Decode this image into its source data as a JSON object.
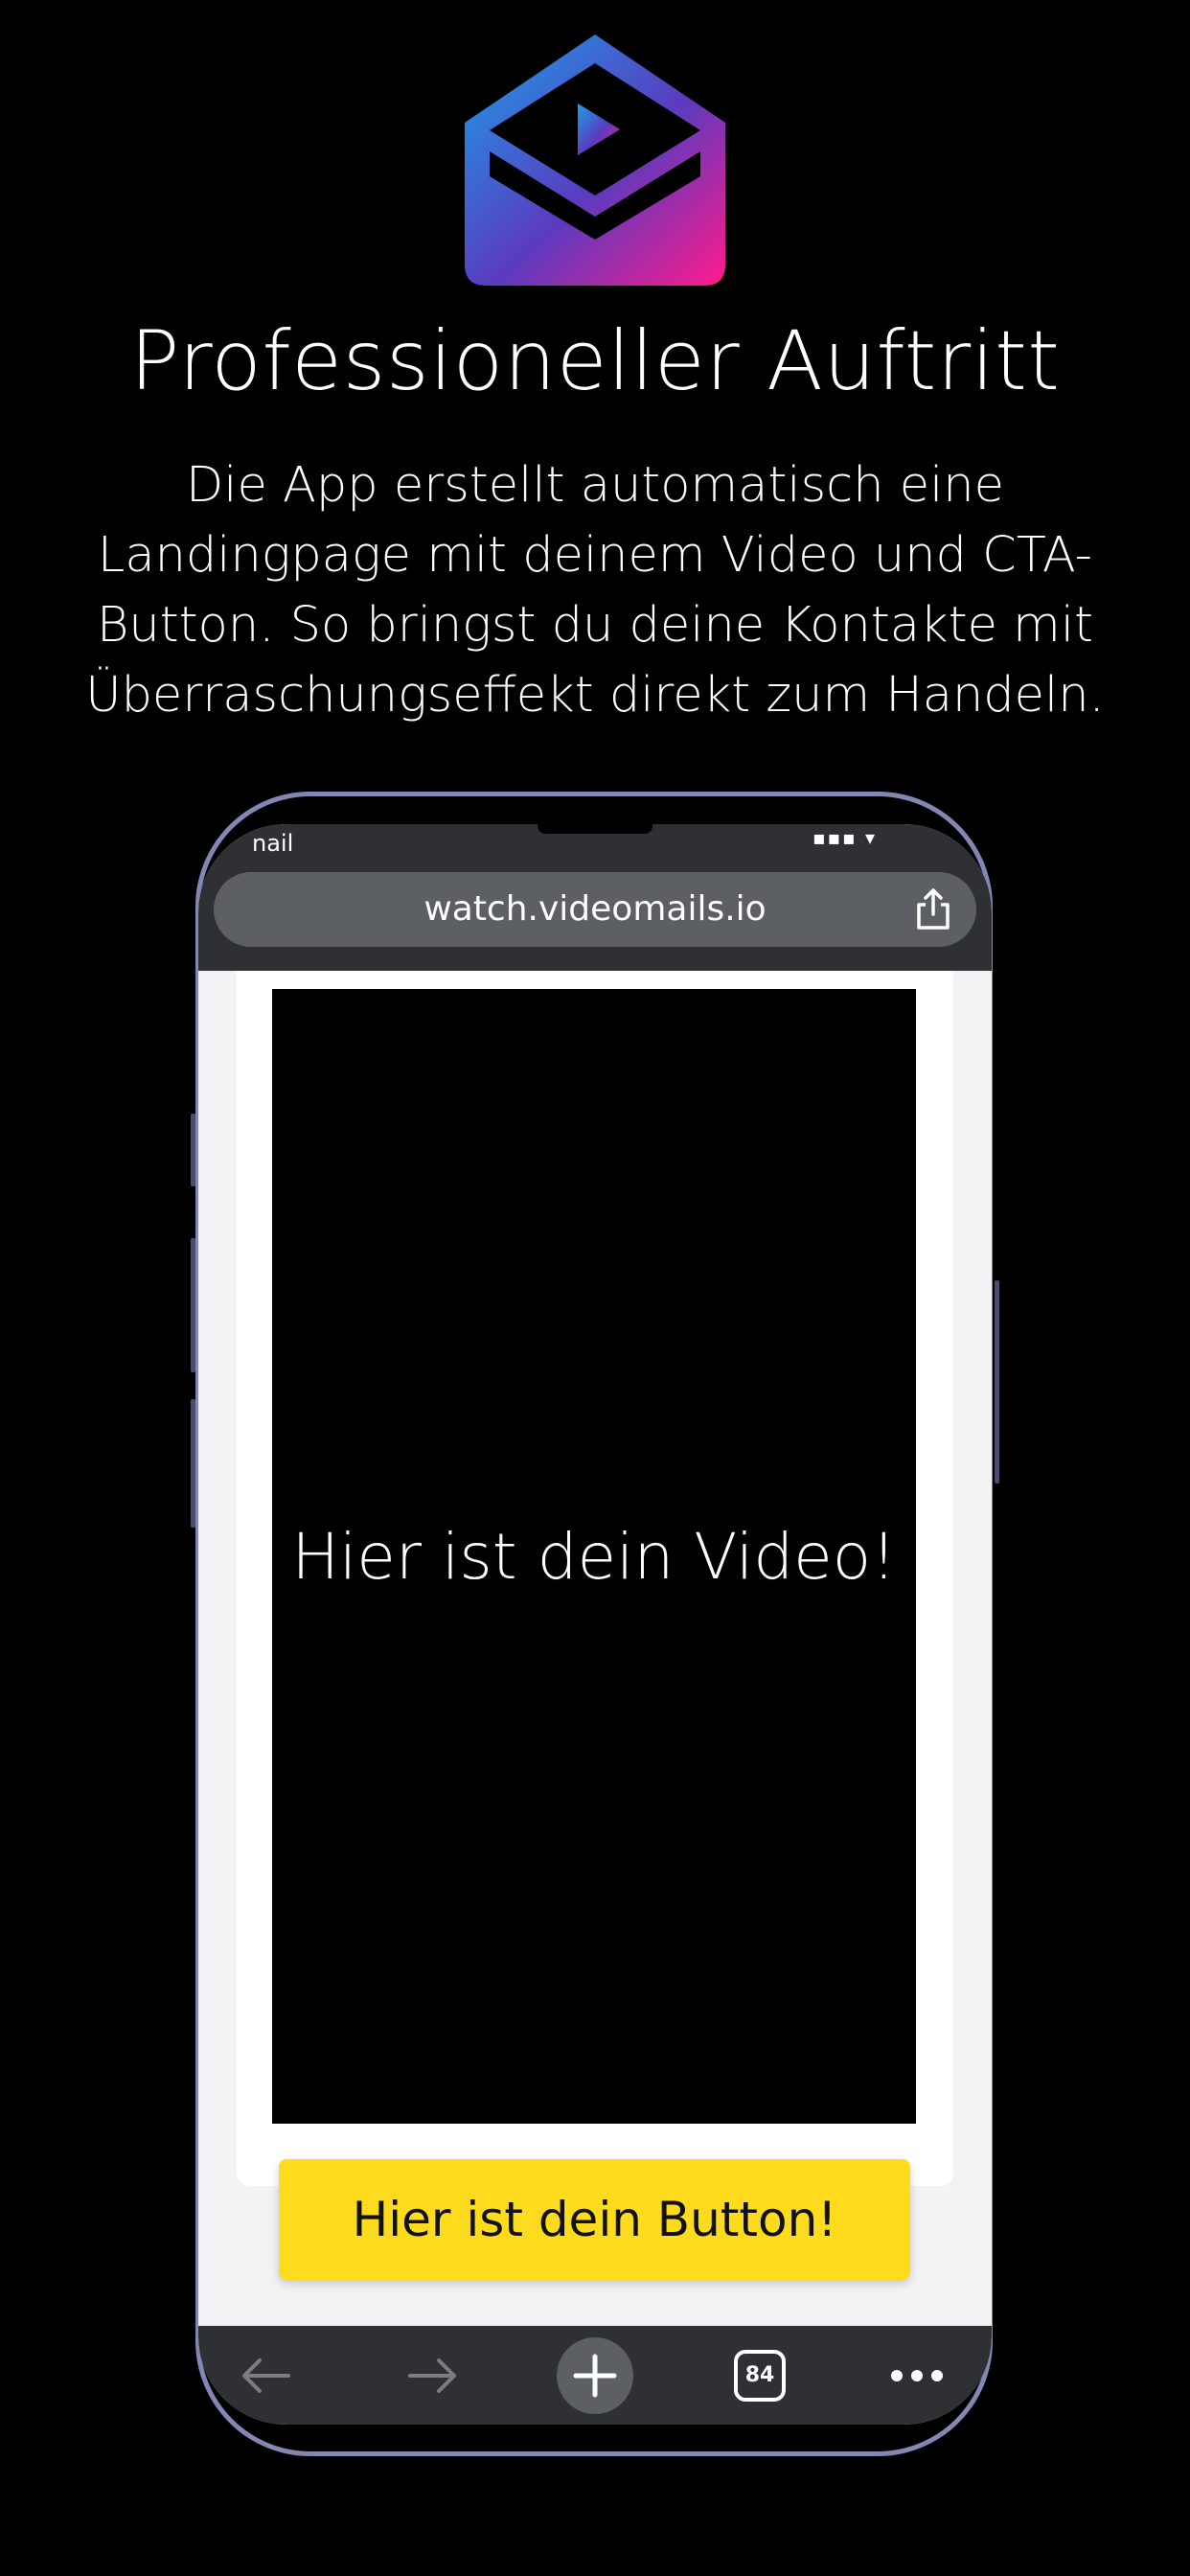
{
  "hero": {
    "headline": "Professioneller Auftritt",
    "description": "Die App erstellt automatisch eine Landingpage mit deinem Video und CTA-Button. So bringst du deine Kontakte mit Überraschungseffekt direkt zum Handeln."
  },
  "brand": {
    "logo_icon": "envelope-play-icon",
    "gradient_colors": [
      "#1aa0e8",
      "#5a3bbf",
      "#ff1a8c"
    ]
  },
  "phone": {
    "status_bar": {
      "carrier": "nail"
    },
    "browser": {
      "url": "watch.videomails.io",
      "share_icon": "share-icon",
      "tab_count": "84",
      "nav_icons": [
        "back-arrow-icon",
        "forward-arrow-icon",
        "new-tab-plus-icon",
        "tabs-icon",
        "more-icon"
      ]
    },
    "landing": {
      "video_placeholder": "Hier ist dein Video!",
      "cta_label": "Hier ist dein Button!"
    }
  },
  "colors": {
    "background": "#000000",
    "cta": "#fedc1d",
    "phone_frame": "#8486b4",
    "browser_bar": "#2e3033"
  }
}
